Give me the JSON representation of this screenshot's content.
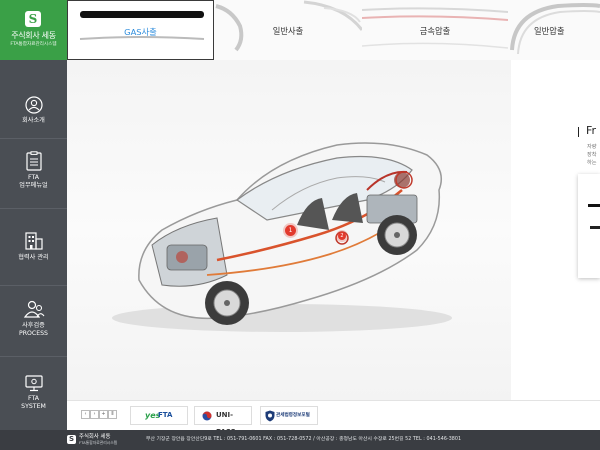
{
  "company": {
    "name": "주식회사 세동",
    "sub": "FTA통합자료관리시스템"
  },
  "sidebar": {
    "items": [
      {
        "label": "회사소개",
        "icon": "user-circle-icon"
      },
      {
        "label": "FTA\n업무메뉴얼",
        "icon": "document-list-icon"
      },
      {
        "label": "협력사 관리",
        "icon": "building-icon"
      },
      {
        "label": "사후검증\nPROCESS",
        "icon": "people-icon"
      },
      {
        "label": "FTA\nSYSTEM",
        "icon": "monitor-icon"
      }
    ]
  },
  "tabs": [
    {
      "label": "GAS사출",
      "active": true
    },
    {
      "label": "일반사출",
      "active": false
    },
    {
      "label": "금속압출",
      "active": false
    },
    {
      "label": "일반압출",
      "active": false
    }
  ],
  "hotspots": [
    "1",
    "2"
  ],
  "panel": {
    "title": "Fr",
    "lines": [
      "자량",
      "장착",
      "하는"
    ]
  },
  "partners": {
    "pager": [
      "‹",
      "›",
      "+",
      "Ⅱ"
    ],
    "logos": [
      "FTA",
      "UNI-PASS",
      "관세법령정보포털"
    ]
  },
  "footer": {
    "info": "부산 기장군 장안읍 장안산단9로    TEL : 051-791-0601    FAX : 051-728-0572    /    아산공장 : 충청남도 아산시 수장로 25번길 52    TEL : 041-546-3801"
  },
  "colors": {
    "brand_green": "#3aa047",
    "sidebar": "#4a4e54",
    "footer": "#3a3d42",
    "active_tab_text": "#2d8cdc",
    "hotspot": "#e23a2d"
  }
}
